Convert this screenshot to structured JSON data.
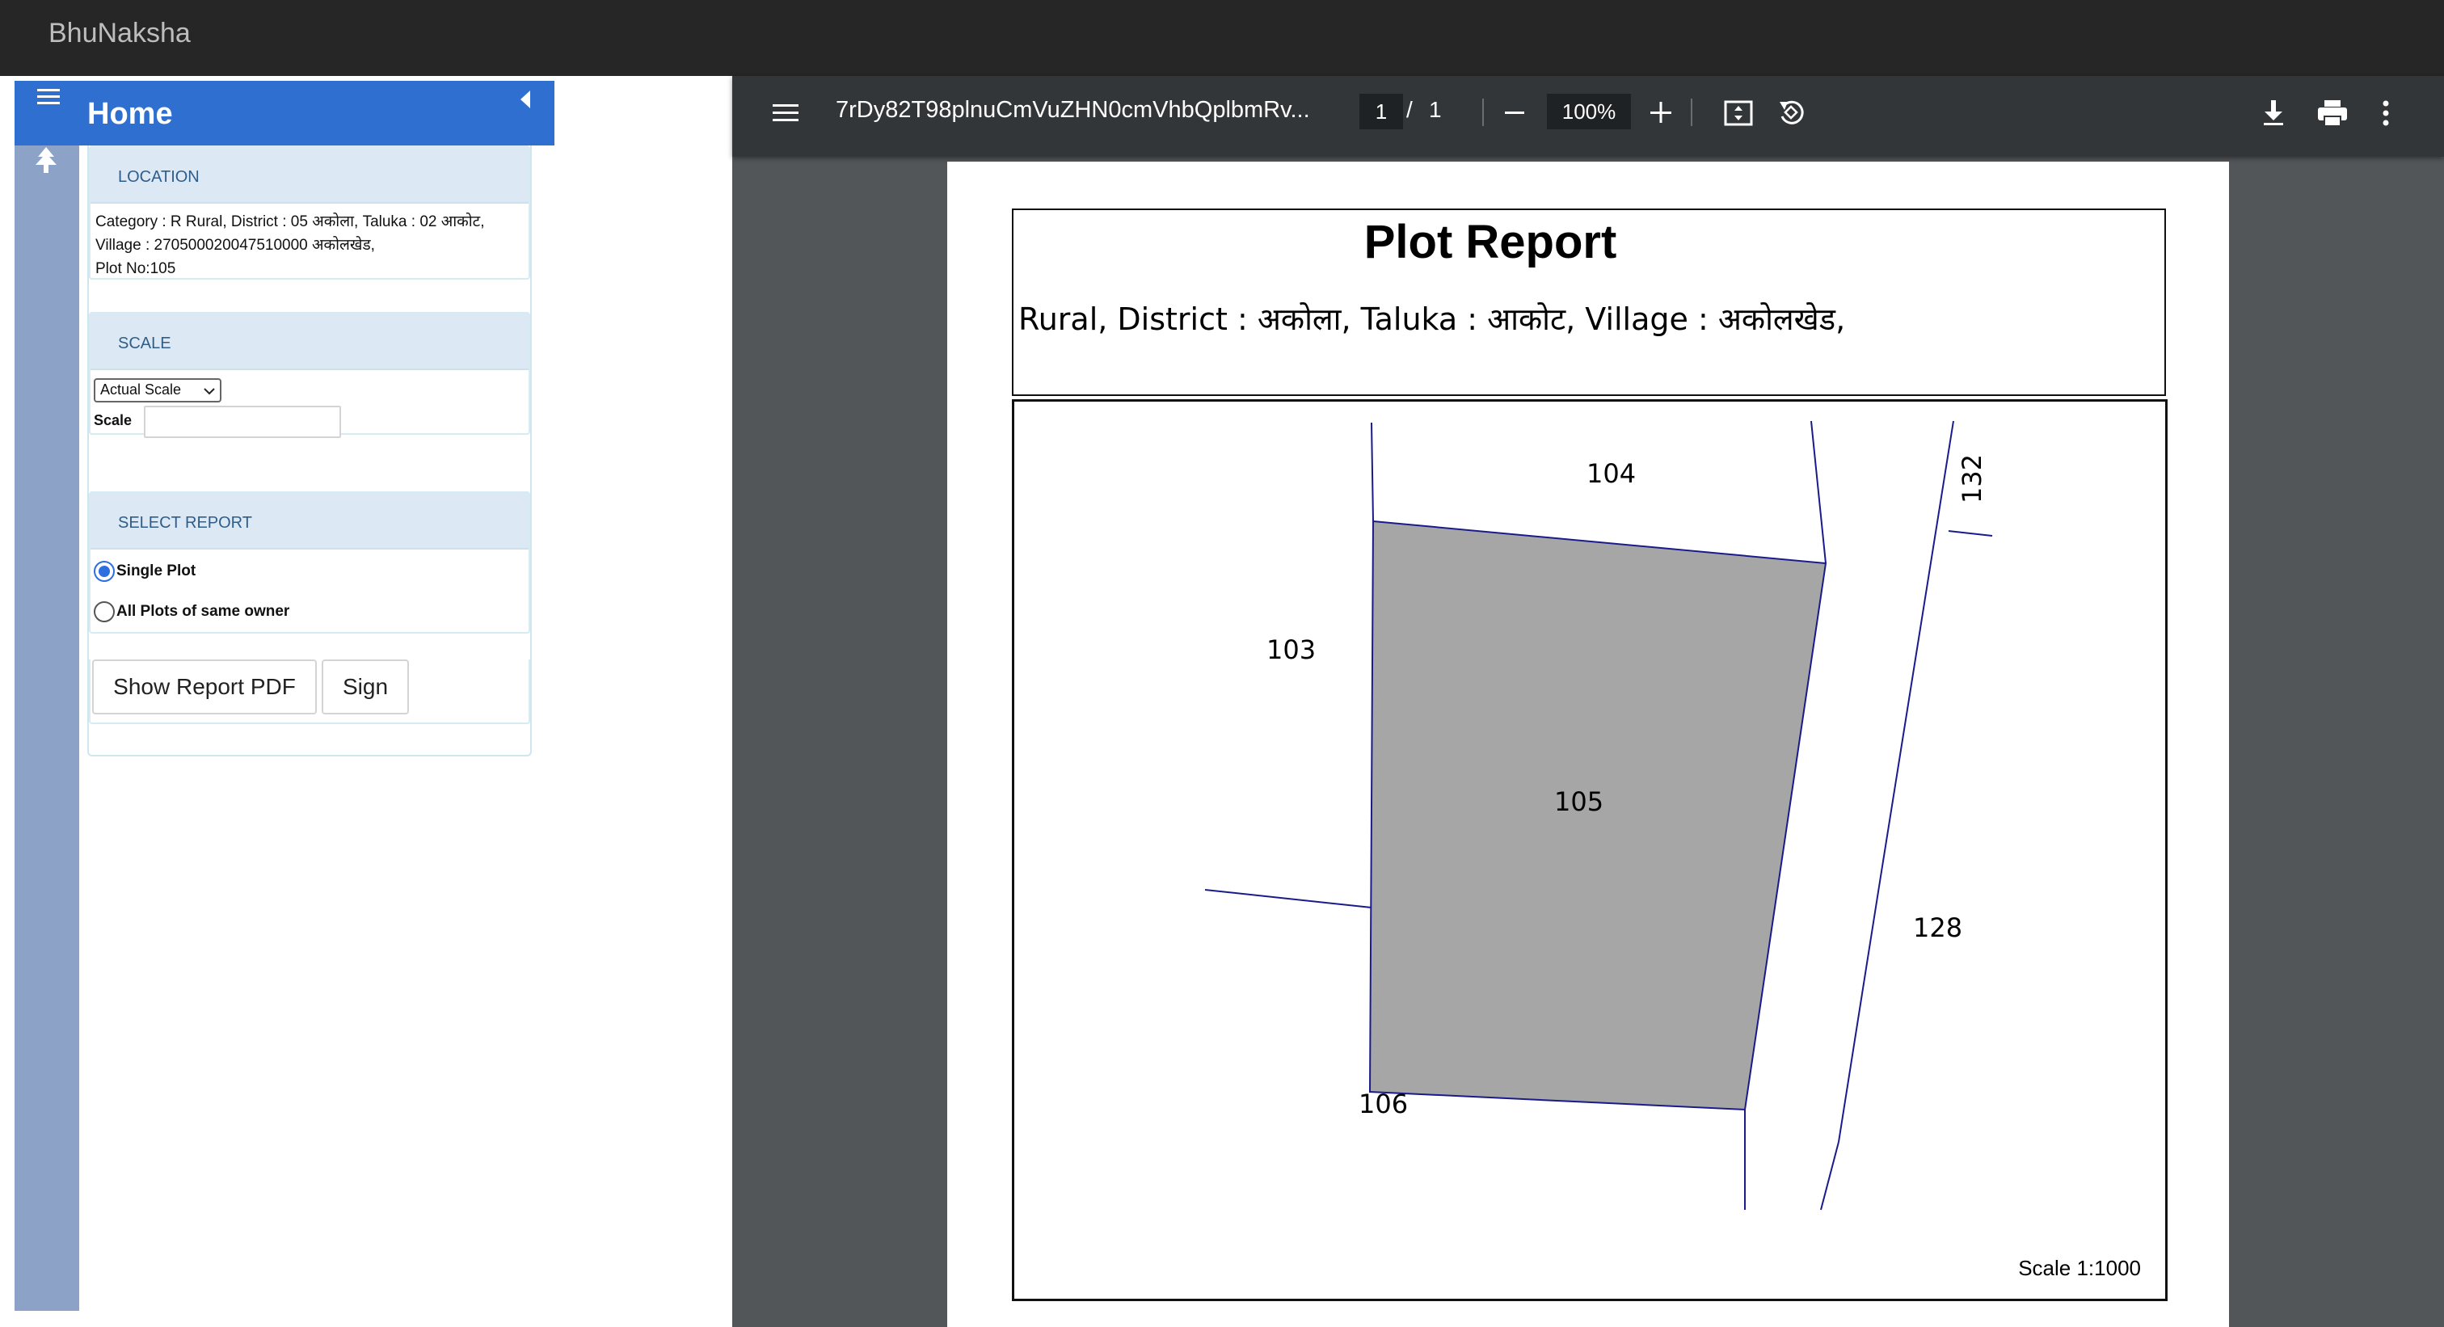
{
  "app": {
    "title": "BhuNaksha"
  },
  "sidebar": {
    "home_label": "Home",
    "location": {
      "heading": "LOCATION",
      "line1": "Category : R Rural, District : 05 अकोला, Taluka : 02 आकोट,",
      "line2": "Village : 270500020047510000 अकोलखेड,",
      "line3": "Plot No:105"
    },
    "scale": {
      "heading": "SCALE",
      "selected": "Actual Scale",
      "label": "Scale",
      "value": ""
    },
    "report": {
      "heading": "SELECT REPORT",
      "options": [
        {
          "label": "Single Plot",
          "checked": true
        },
        {
          "label": "All Plots of same owner",
          "checked": false
        }
      ]
    },
    "buttons": {
      "show_pdf": "Show Report PDF",
      "sign": "Sign"
    }
  },
  "viewer": {
    "file_name": "7rDy82T98plnuCmVuZHN0cmVhbQplbmRv...",
    "current_page": "1",
    "separator": "/",
    "total_pages": "1",
    "zoom": "100%",
    "icons": [
      "menu-icon",
      "minus-icon",
      "plus-icon",
      "fit-page-icon",
      "rotate-icon",
      "download-icon",
      "print-icon",
      "more-icon"
    ],
    "colors": {
      "toolbar": "#323639",
      "background": "#525659"
    }
  },
  "report": {
    "title": "Plot Report",
    "subtitle": "Rural, District : अकोला, Taluka : आकोट, Village : अकोलखेड,",
    "scale_note": "Scale 1:1000",
    "plot_labels": {
      "main": "105",
      "north": "104",
      "west": "103",
      "southwest": "106",
      "east": "128",
      "northeast": "132"
    },
    "colors": {
      "plot_fill": "#a6a6a6",
      "boundary": "#1a1a8c"
    }
  }
}
